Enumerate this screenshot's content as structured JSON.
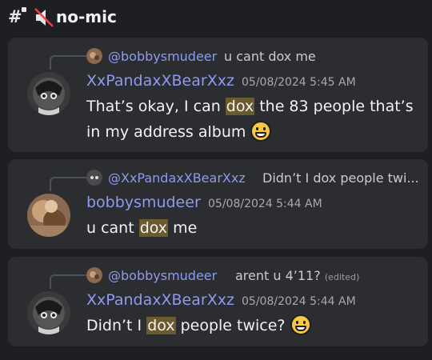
{
  "header": {
    "hash_symbol": "#",
    "channel_name": "no-mic"
  },
  "messages": [
    {
      "reply_to_name": "@bobbysmudeer",
      "reply_to_text": "u cant dox me",
      "author": "XxPandaxXBearXxz",
      "timestamp": "05/08/2024 5:45 AM",
      "content_before": "That’s okay, I can ",
      "highlight": "dox",
      "content_after": " the 83 people that’s in my address album",
      "emoji": "grinning-face-emoji",
      "author_color": "#8e9aef"
    },
    {
      "reply_to_name": "@XxPandaxXBearXxz",
      "reply_to_text": "Didn’t I dox people twi...",
      "author": "bobbysmudeer",
      "timestamp": "05/08/2024 5:44 AM",
      "content_before": "u cant ",
      "highlight": "dox",
      "content_after": " me",
      "author_color": "#8e9aef"
    },
    {
      "reply_to_name": "@bobbysmudeer",
      "reply_to_text": "arent u 4’11?",
      "reply_edited": "(edited)",
      "author": "XxPandaxXBearXxz",
      "timestamp": "05/08/2024 5:44 AM",
      "content_before": "Didn’t I ",
      "highlight": "dox",
      "content_after": " people twice?",
      "emoji": "grinning-face-emoji",
      "author_color": "#8e9aef"
    }
  ],
  "colors": {
    "background": "#1e1f22",
    "card": "#2b2d31",
    "highlight": "#6b5a2e",
    "mention": "#8e9aef"
  }
}
